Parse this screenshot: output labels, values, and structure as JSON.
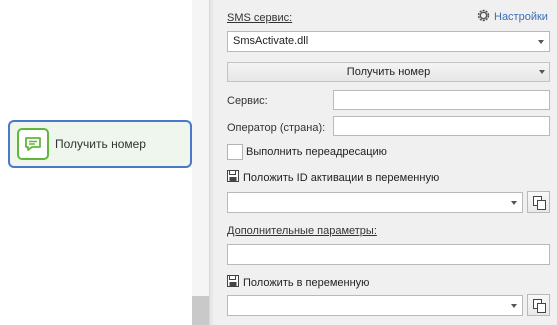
{
  "canvas": {
    "node": {
      "label": "Получить номер",
      "icon": "message-icon"
    }
  },
  "panel": {
    "sms_service": {
      "title": "SMS сервис:",
      "settings_label": "Настройки",
      "settings_icon": "gear-icon",
      "selected": "SmsActivate.dll"
    },
    "action_button": "Получить номер",
    "service": {
      "label": "Сервис:",
      "value": ""
    },
    "operator": {
      "label": "Оператор (страна):",
      "value": ""
    },
    "redirect": {
      "label": "Выполнить переадресацию",
      "checked": false
    },
    "activation_var": {
      "label": "Положить ID активации в переменную",
      "value": ""
    },
    "extra_params": {
      "title": "Дополнительные параметры:",
      "value": ""
    },
    "output_var": {
      "label": "Положить в переменную",
      "value": ""
    }
  },
  "colors": {
    "accent": "#4a79c9",
    "node_icon": "#62b73b",
    "link": "#3c6fb6"
  }
}
